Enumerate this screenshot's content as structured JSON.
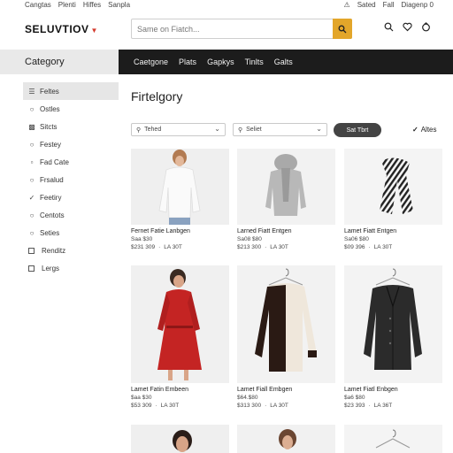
{
  "topbar": {
    "left": [
      "Cangtas",
      "Plenti",
      "Hiffes",
      "Sanpla"
    ],
    "right": [
      "Sated",
      "Fall",
      "Diagenp 0"
    ]
  },
  "header": {
    "logo": "SELUVTIOV",
    "search_placeholder": "Same on Fiatch..."
  },
  "category_bar": {
    "title": "Category",
    "tabs": [
      "Caetgone",
      "Plats",
      "Gapkys",
      "Tinlts",
      "Galts"
    ]
  },
  "sidebar": {
    "items": [
      {
        "icon": "list-icon",
        "label": "Feltes",
        "active": true
      },
      {
        "icon": "circle-icon",
        "label": "Ostles"
      },
      {
        "icon": "bag-icon",
        "label": "Sitcts"
      },
      {
        "icon": "circle-icon",
        "label": "Festey"
      },
      {
        "icon": "folder-icon",
        "label": "Fad Cate"
      },
      {
        "icon": "circle-icon",
        "label": "Frsalud"
      },
      {
        "icon": "check-icon",
        "label": "Feetiry"
      },
      {
        "icon": "circle-icon",
        "label": "Centots"
      },
      {
        "icon": "circle-icon",
        "label": "Seties"
      },
      {
        "icon": "box-icon",
        "label": "Renditz"
      },
      {
        "icon": "box-icon",
        "label": "Lergs"
      }
    ]
  },
  "main": {
    "title": "Firtelgory",
    "filter1": "Tehed",
    "filter2": "Seliet",
    "sort_label": "Sat Tbrt",
    "filters_label": "Altes"
  },
  "products": [
    {
      "name": "Fernet Fatie Lanbgen",
      "price1": "Saa $30",
      "price2a": "$231 309",
      "price2b": "LA 30T",
      "image": "white-sweater"
    },
    {
      "name": "Larned Fiatt Entgen",
      "price1": "Sa08 $80",
      "price2a": "$213 300",
      "price2b": "LA 30T",
      "image": "gray-scarf"
    },
    {
      "name": "Lamet Fiatt Entgen",
      "price1": "Sa06 $80",
      "price2a": "$09 396",
      "price2b": "LA 30T",
      "image": "zebra-scarf"
    },
    {
      "name": "Lamet Fatin Embeen",
      "price1": "$aa $30",
      "price2a": "$53 309",
      "price2b": "LA 30T",
      "image": "red-dress"
    },
    {
      "name": "Lamet Fiall Embgen",
      "price1": "$64.$80",
      "price2a": "$313 300",
      "price2b": "LA 30T",
      "image": "cardigan"
    },
    {
      "name": "Lamet Fiatl Enbgen",
      "price1": "$a6 $80",
      "price2a": "$23 393",
      "price2b": "LA 36T",
      "image": "black-cardigan"
    }
  ]
}
